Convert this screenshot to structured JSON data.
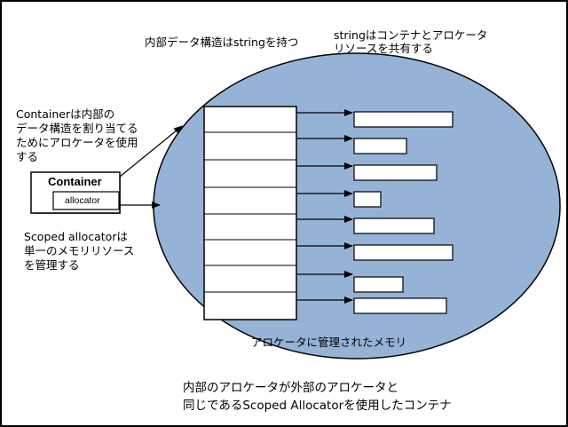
{
  "labels": {
    "internal_uses_string": "内部データ構造はstringを持つ",
    "string_shares_line1": "stringはコンテナとアロケータ",
    "string_shares_line2": "リソースを共有する",
    "container_alloc_line1": "Containerは内部の",
    "container_alloc_line2": "データ構造を割り当てる",
    "container_alloc_line3": "ためにアロケータを使用",
    "container_alloc_line4": "する",
    "scoped_line1": "Scoped allocatorは",
    "scoped_line2": "単一のメモリリソース",
    "scoped_line3": "を管理する",
    "managed_memory": "アロケータに管理されたメモリ",
    "bottom_line1": "内部のアロケータが外部のアロケータと",
    "bottom_line2": "同じであるScoped Allocatorを使用したコンテナ"
  },
  "container_box": {
    "title": "Container",
    "allocator": "allocator"
  },
  "colors": {
    "memory_fill": "#95b3d7",
    "stroke": "#000000",
    "box_fill": "#ffffff"
  }
}
